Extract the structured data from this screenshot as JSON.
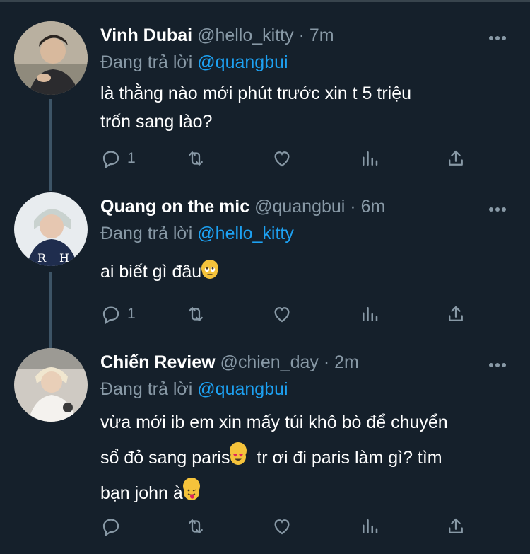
{
  "tweets": [
    {
      "name": "Vinh Dubai",
      "handle": "@hello_kitty",
      "dot": "·",
      "time": "7m",
      "replying_prefix": "Đang trả lời",
      "replying_to": "@quangbui",
      "text_lines": [
        "là thằng nào mới phút trước xin t 5 triệu",
        "trốn sang lào?"
      ],
      "reply_count": "1"
    },
    {
      "name": "Quang on the mic",
      "handle": "@quangbui",
      "dot": "·",
      "time": "6m",
      "replying_prefix": "Đang trả lời",
      "replying_to": "@hello_kitty",
      "text": "ai biết gì đâu",
      "emoji": "rolling-eyes-emoji",
      "reply_count": "1"
    },
    {
      "name": "Chiến Review",
      "handle": "@chien_day",
      "dot": "·",
      "time": "2m",
      "replying_prefix": "Đang trả lời",
      "replying_to": "@quangbui",
      "line1": "vừa mới ib em xin mấy túi khô bò để chuyển",
      "line2a": "sổ đỏ sang paris",
      "line2b": "  tr ơi đi paris làm gì? tìm",
      "line3": "bạn john à",
      "emoji1": "heart-eyes-emoji",
      "emoji2": "tongue-out-emoji",
      "reply_count": ""
    }
  ],
  "colors": {
    "background": "#15202b",
    "accent": "#1da1f2",
    "muted": "#8899a6"
  }
}
